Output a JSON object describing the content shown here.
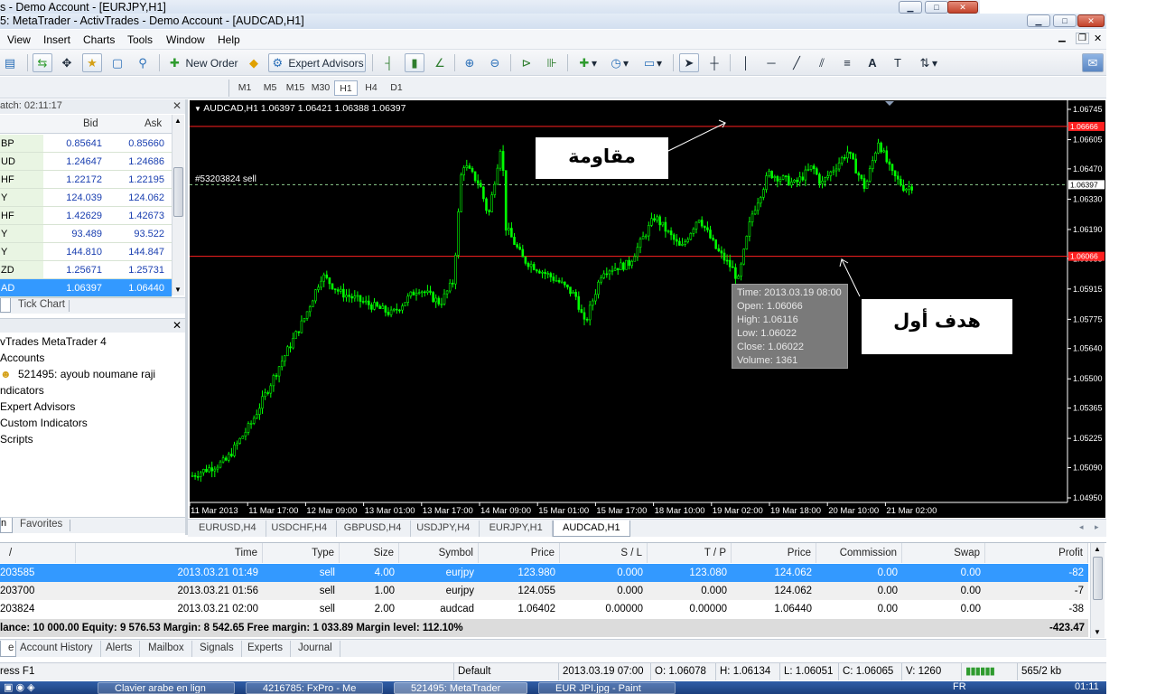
{
  "window": {
    "outer_title": "s - Demo Account - [EURJPY,H1]",
    "inner_title": "5: MetaTrader - ActivTrades - Demo Account - [AUDCAD,H1]"
  },
  "menu": [
    "View",
    "Insert",
    "Charts",
    "Tools",
    "Window",
    "Help"
  ],
  "toolbar": {
    "new_order": "New Order",
    "expert_advisors": "Expert Advisors"
  },
  "timeframes": [
    "M1",
    "M5",
    "M15",
    "M30",
    "H1",
    "H4",
    "D1"
  ],
  "active_timeframe": "H1",
  "market_watch": {
    "header": "atch: 02:11:17",
    "col_bid": "Bid",
    "col_ask": "Ask",
    "rows": [
      {
        "sym": "BP",
        "bid": "0.85641",
        "ask": "0.85660"
      },
      {
        "sym": "UD",
        "bid": "1.24647",
        "ask": "1.24686"
      },
      {
        "sym": "HF",
        "bid": "1.22172",
        "ask": "1.22195"
      },
      {
        "sym": "Y",
        "bid": "124.039",
        "ask": "124.062"
      },
      {
        "sym": "HF",
        "bid": "1.42629",
        "ask": "1.42673"
      },
      {
        "sym": "Y",
        "bid": "93.489",
        "ask": "93.522"
      },
      {
        "sym": "Y",
        "bid": "144.810",
        "ask": "144.847"
      },
      {
        "sym": "ZD",
        "bid": "1.25671",
        "ask": "1.25731"
      },
      {
        "sym": "AD",
        "bid": "1.06397",
        "ask": "1.06440"
      }
    ],
    "tab_tick_chart": "Tick Chart"
  },
  "navigator": {
    "items": [
      "vTrades MetaTrader 4",
      "Accounts",
      "521495: ayoub noumane raji",
      "ndicators",
      "Expert Advisors",
      "Custom Indicators",
      "Scripts"
    ],
    "tab_favorites": "Favorites"
  },
  "chart": {
    "header": "AUDCAD,H1  1.06397 1.06421 1.06388 1.06397",
    "order_label": "#53203824 sell",
    "resistance_price": "1.06666",
    "target_price": "1.06066",
    "current_price": "1.06397",
    "price_ticks": [
      "1.06745",
      "1.06605",
      "1.06470",
      "1.06330",
      "1.06190",
      "1.06055",
      "1.05915",
      "1.05775",
      "1.05640",
      "1.05500",
      "1.05365",
      "1.05225",
      "1.05090",
      "1.04950"
    ],
    "time_ticks": [
      "11 Mar 2013",
      "11 Mar 17:00",
      "12 Mar 09:00",
      "13 Mar 01:00",
      "13 Mar 17:00",
      "14 Mar 09:00",
      "15 Mar 01:00",
      "15 Mar 17:00",
      "18 Mar 10:00",
      "19 Mar 02:00",
      "19 Mar 18:00",
      "20 Mar 10:00",
      "21 Mar 02:00"
    ],
    "tooltip": [
      "Time: 2013.03.19 08:00",
      "Open: 1.06066",
      "High: 1.06116",
      "Low:  1.06022",
      "Close: 1.06022",
      "Volume: 1361"
    ],
    "annotation_resistance": "مقاومة",
    "annotation_target": "هدف أول",
    "colors": {
      "candles": "#00ff00",
      "levels": "#ff2020",
      "background": "#000000"
    }
  },
  "chart_tabs": [
    "EURUSD,H4",
    "USDCHF,H4",
    "GBPUSD,H4",
    "USDJPY,H4",
    "EURJPY,H1",
    "AUDCAD,H1"
  ],
  "active_chart_tab": "AUDCAD,H1",
  "terminal": {
    "columns": [
      "/",
      "Time",
      "Type",
      "Size",
      "Symbol",
      "Price",
      "S / L",
      "T / P",
      "Price",
      "Commission",
      "Swap",
      "Profit"
    ],
    "rows": [
      {
        "order": "203585",
        "time": "2013.03.21 01:49",
        "type": "sell",
        "size": "4.00",
        "symbol": "eurjpy",
        "price": "123.980",
        "sl": "0.000",
        "tp": "123.080",
        "cur": "124.062",
        "commission": "0.00",
        "swap": "0.00",
        "profit": "-82"
      },
      {
        "order": "203700",
        "time": "2013.03.21 01:56",
        "type": "sell",
        "size": "1.00",
        "symbol": "eurjpy",
        "price": "124.055",
        "sl": "0.000",
        "tp": "0.000",
        "cur": "124.062",
        "commission": "0.00",
        "swap": "0.00",
        "profit": "-7"
      },
      {
        "order": "203824",
        "time": "2013.03.21 02:00",
        "type": "sell",
        "size": "2.00",
        "symbol": "audcad",
        "price": "1.06402",
        "sl": "0.00000",
        "tp": "0.00000",
        "cur": "1.06440",
        "commission": "0.00",
        "swap": "0.00",
        "profit": "-38"
      }
    ],
    "balance_line": "lance: 10 000.00  Equity: 9 576.53  Margin: 8 542.65  Free margin: 1 033.89  Margin level: 112.10%",
    "total_profit": "-423.47",
    "tabs": [
      "Account History",
      "Alerts",
      "Mailbox",
      "Signals",
      "Experts",
      "Journal"
    ]
  },
  "status": {
    "help": "ress F1",
    "profile": "Default",
    "time": "2013.03.19 07:00",
    "open": "O: 1.06078",
    "high": "H: 1.06134",
    "low": "L: 1.06051",
    "close": "C: 1.06065",
    "volume": "V: 1260",
    "traffic": "565/2 kb"
  },
  "taskbar": {
    "items": [
      "Clavier arabe en lign",
      "4216785: FxPro - Me",
      "521495: MetaTrader",
      "EUR JPI.jpg - Paint"
    ],
    "lang": "FR",
    "clock": "01:11"
  }
}
